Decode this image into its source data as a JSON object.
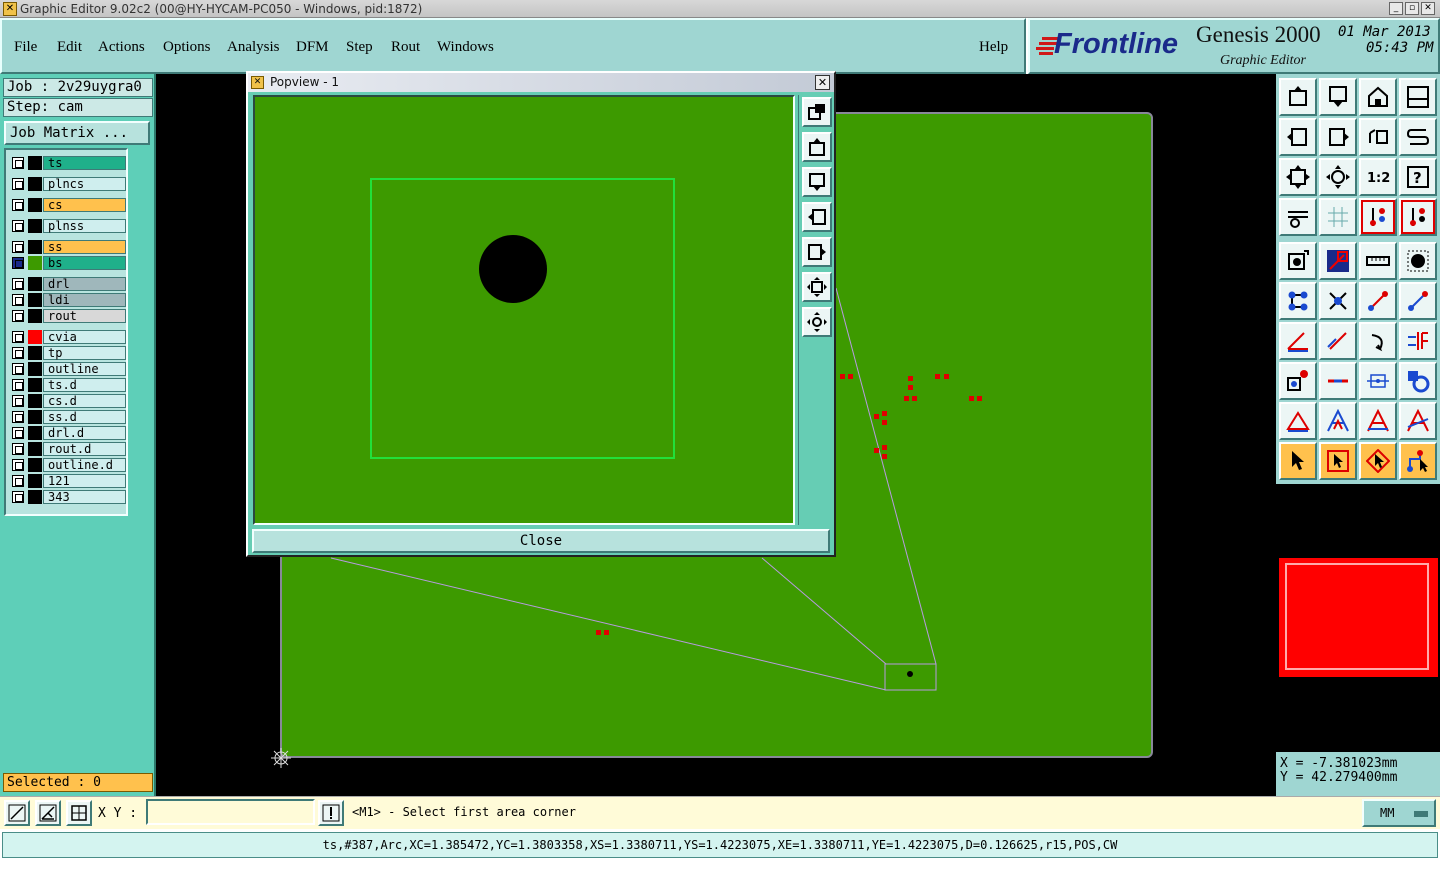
{
  "window": {
    "title": "Graphic Editor 9.02c2 (00@HY-HYCAM-PC050 - Windows, pid:1872)"
  },
  "menu": [
    "File",
    "Edit",
    "Actions",
    "Options",
    "Analysis",
    "DFM",
    "Step",
    "Rout",
    "Windows"
  ],
  "help_label": "Help",
  "brand": {
    "logo": "Frontline",
    "product": "Genesis 2000",
    "subtitle": "Graphic Editor",
    "date": "01 Mar 2013",
    "time": "05:43 PM"
  },
  "job": {
    "job_line": "Job : 2v29uygra0",
    "step_line": "Step: cam",
    "matrix_button": "Job Matrix ..."
  },
  "layers": [
    {
      "name": "ts",
      "color": "#1fb08a"
    },
    {
      "name": "plncs",
      "color": "#cfeeee"
    },
    {
      "name": "cs",
      "color": "#ffc14d"
    },
    {
      "name": "plnss",
      "color": "#cfeeee"
    },
    {
      "name": "ss",
      "color": "#ffc14d"
    },
    {
      "name": "bs",
      "color": "#1fb08a"
    },
    {
      "name": "drl",
      "color": "#9fb7bb"
    },
    {
      "name": "ldi",
      "color": "#9fb7bb"
    },
    {
      "name": "rout",
      "color": "#d8d8d8"
    },
    {
      "name": "cvia",
      "color": "#cfeeee"
    },
    {
      "name": "tp",
      "color": "#cfeeee"
    },
    {
      "name": "outline",
      "color": "#cfeeee"
    },
    {
      "name": "ts.d",
      "color": "#cfeeee"
    },
    {
      "name": "cs.d",
      "color": "#cfeeee"
    },
    {
      "name": "ss.d",
      "color": "#cfeeee"
    },
    {
      "name": "drl.d",
      "color": "#cfeeee"
    },
    {
      "name": "rout.d",
      "color": "#cfeeee"
    },
    {
      "name": "outline.d",
      "color": "#cfeeee"
    },
    {
      "name": "121",
      "color": "#cfeeee"
    },
    {
      "name": "343",
      "color": "#cfeeee"
    }
  ],
  "selected_text": "Selected : 0",
  "popview": {
    "title": "Popview - 1",
    "close_label": "Close"
  },
  "coords": {
    "x": "X = -7.381023mm",
    "y": "Y = 42.279400mm"
  },
  "command": {
    "xy_label": "X Y :",
    "xy_value": "",
    "prompt": "<M1> - Select first area corner",
    "units": "MM"
  },
  "info": "ts,#387,Arc,XC=1.385472,YC=1.3803358,XS=1.3380711,YS=1.4223075,XE=1.3380711,YE=1.4223075,D=0.126625,r15,POS,CW",
  "colors": {
    "panel": "#9fd6d2",
    "board": "#3d9a00",
    "feature": "#ff0000",
    "accent": "#ffc14d"
  }
}
